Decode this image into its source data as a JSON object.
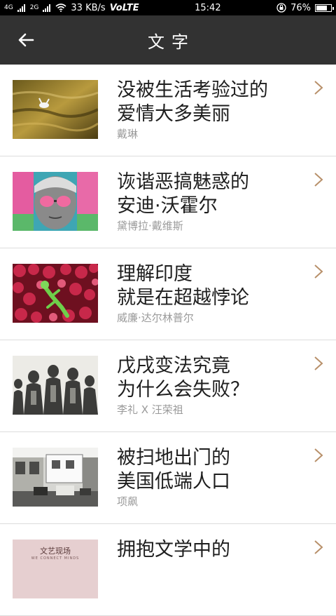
{
  "status": {
    "signal_labels": [
      "4G",
      "2G"
    ],
    "speed": "33 KB/s",
    "volte": "VoLTE",
    "time": "15:42",
    "battery": "76%",
    "battery_level": 0.76
  },
  "header": {
    "title": "文字"
  },
  "articles": [
    {
      "title": "没被生活考验过的\n爱情大多美丽",
      "author": "戴琳"
    },
    {
      "title": "诙谐恶搞魅惑的\n安迪·沃霍尔",
      "author": "黛博拉·戴维斯"
    },
    {
      "title": "理解印度\n就是在超越悖论",
      "author": "威廉·达尔林普尔"
    },
    {
      "title": "戊戌变法究竟\n为什么会失败？",
      "author": "李礼 X 汪荣祖"
    },
    {
      "title": "被扫地出门的\n美国低端人口",
      "author": "项飙"
    },
    {
      "title": "拥抱文学中的",
      "author": "",
      "thumb_text": [
        "文艺现场",
        "WE CONNECT MINDS"
      ]
    }
  ],
  "colors": {
    "appbar": "#323232",
    "chevron": "#b8906a",
    "divider": "#dcdcdc",
    "author": "#9a9a9a"
  }
}
